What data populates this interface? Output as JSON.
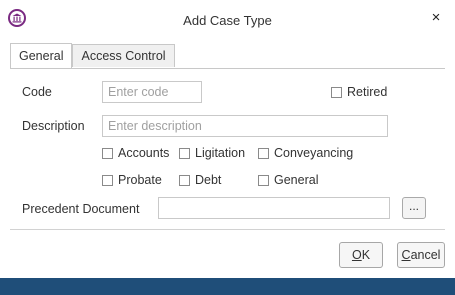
{
  "window": {
    "title": "Add Case Type",
    "close_glyph": "×",
    "icon": "pillared-building-icon",
    "accent_color": "#7a2a82",
    "statusbar_color": "#1f4e79"
  },
  "tabs": [
    {
      "label": "General",
      "active": true
    },
    {
      "label": "Access Control",
      "active": false
    }
  ],
  "form": {
    "code_label": "Code",
    "code_placeholder": "Enter code",
    "retired_label": "Retired",
    "description_label": "Description",
    "description_placeholder": "Enter description",
    "checkboxes": [
      {
        "label": "Accounts",
        "checked": false
      },
      {
        "label": "Ligitation",
        "checked": false
      },
      {
        "label": "Conveyancing",
        "checked": false
      },
      {
        "label": "Probate",
        "checked": false
      },
      {
        "label": "Debt",
        "checked": false
      },
      {
        "label": "General",
        "checked": false
      }
    ],
    "precedent_label": "Precedent Document",
    "precedent_value": "",
    "browse_label": "..."
  },
  "buttons": {
    "ok_mnemonic": "O",
    "ok_rest": "K",
    "cancel_mnemonic": "C",
    "cancel_rest": "ancel"
  }
}
